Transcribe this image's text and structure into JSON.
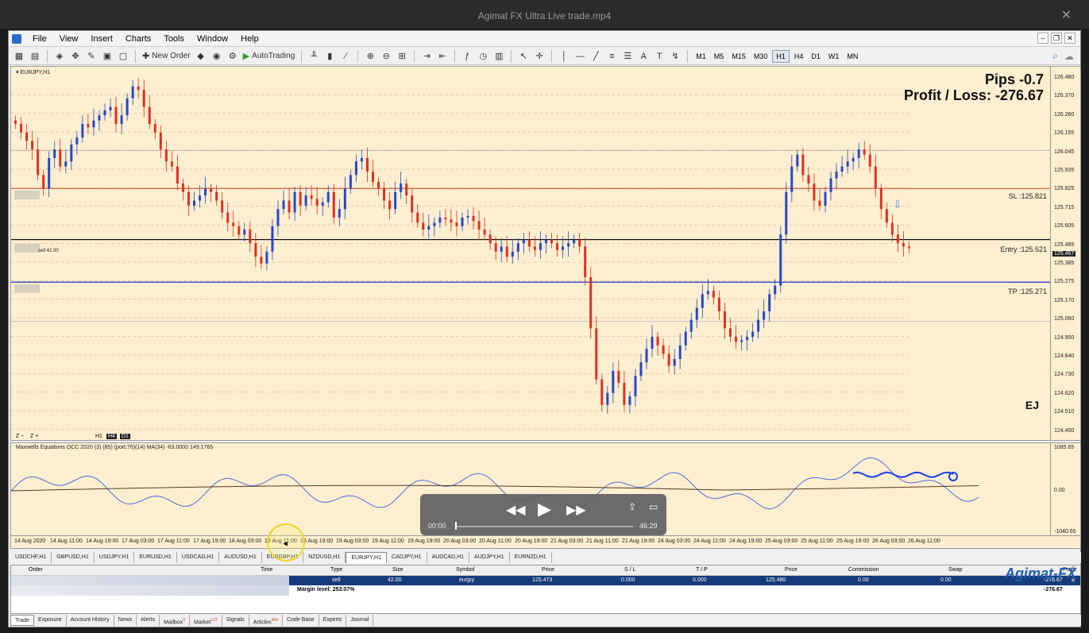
{
  "video": {
    "title": "Agimat FX Ultra Live trade.mp4"
  },
  "menu": [
    "File",
    "View",
    "Insert",
    "Charts",
    "Tools",
    "Window",
    "Help"
  ],
  "toolbar": {
    "new_order": "New Order",
    "autotrading": "AutoTrading",
    "timeframes": [
      "M1",
      "M5",
      "M15",
      "M30",
      "H1",
      "H4",
      "D1",
      "W1",
      "MN"
    ],
    "active_tf": "H1"
  },
  "chart": {
    "symbol": "EURJPY,H1",
    "pips": "Pips -0.7",
    "profit_loss": "Profit / Loss: -276.67",
    "ej": "EJ",
    "sl_label": "SL :125.821",
    "entry_label": "Entry :125.521",
    "tp_label": "TP :125.271",
    "trade_tag": "sell 42.00",
    "current_price": "125.467",
    "tf_mini": [
      "H1",
      "H4",
      "D1"
    ],
    "price_ticks": [
      "126.480",
      "126.370",
      "126.260",
      "126.155",
      "126.045",
      "125.935",
      "125.825",
      "125.715",
      "125.605",
      "125.495",
      "125.385",
      "125.275",
      "125.170",
      "125.060",
      "124.950",
      "124.840",
      "124.730",
      "124.620",
      "124.510",
      "124.400"
    ],
    "time_ticks": [
      "14 Aug 2020",
      "14 Aug 11:00",
      "14 Aug 19:00",
      "17 Aug 03:00",
      "17 Aug 11:00",
      "17 Aug 19:00",
      "18 Aug 03:00",
      "18 Aug 11:00",
      "18 Aug 19:00",
      "19 Aug 03:00",
      "19 Aug 11:00",
      "19 Aug 19:00",
      "20 Aug 03:00",
      "20 Aug 11:00",
      "20 Aug 19:00",
      "21 Aug 03:00",
      "21 Aug 11:00",
      "21 Aug 19:00",
      "24 Aug 03:00",
      "24 Aug 11:00",
      "24 Aug 19:00",
      "25 Aug 03:00",
      "25 Aug 11:00",
      "25 Aug 19:00",
      "26 Aug 03:00",
      "26 Aug 11:00"
    ]
  },
  "indicator": {
    "label": "Maxwells Equations OCC 2020 (3) (85) (port:76)(14) MA(34) -63.0000 149.1765",
    "ticks": [
      "1085.65",
      "0.00",
      "-1040.65"
    ]
  },
  "symbol_tabs": [
    "USDCHF,H1",
    "GBPUSD,H1",
    "USDJPY,H1",
    "EURUSD,H1",
    "USDCAD,H1",
    "AUDUSD,H1",
    "EURGBP,H1",
    "NZDUSD,H1",
    "EURJPY,H1",
    "CADJPY,H1",
    "AUDCAD,H1",
    "AUDJPY,H1",
    "EURNZD,H1"
  ],
  "active_symbol_tab": "EURJPY,H1",
  "terminal": {
    "headers": [
      "Order",
      "Time",
      "Type",
      "Size",
      "Symbol",
      "Price",
      "S / L",
      "T / P",
      "Price",
      "Commission",
      "Swap",
      "Profit"
    ],
    "row": {
      "type": "sell",
      "size": "42.00",
      "symbol": "eurjpy",
      "price": "125.473",
      "sl": "0.000",
      "tp": "0.000",
      "cur_price": "125.480",
      "commission": "0.00",
      "swap": "0.00",
      "profit": "-276.67"
    },
    "margin": "Margin level: 253.07%",
    "total": "-276.67"
  },
  "bottom_tabs": [
    {
      "label": "Trade",
      "badge": ""
    },
    {
      "label": "Exposure",
      "badge": ""
    },
    {
      "label": "Account History",
      "badge": ""
    },
    {
      "label": "News",
      "badge": ""
    },
    {
      "label": "Alerts",
      "badge": ""
    },
    {
      "label": "Mailbox",
      "badge": "9"
    },
    {
      "label": "Market",
      "badge": "137"
    },
    {
      "label": "Signals",
      "badge": ""
    },
    {
      "label": "Articles",
      "badge": "943"
    },
    {
      "label": "Code Base",
      "badge": ""
    },
    {
      "label": "Experts",
      "badge": ""
    },
    {
      "label": "Journal",
      "badge": ""
    }
  ],
  "player": {
    "current": "00:00",
    "duration": "46:29"
  },
  "brand": "Agimat-FX",
  "colors": {
    "bull": "#2747c9",
    "bear": "#e03020",
    "sl_line": "#e04030",
    "tp_line": "#2030c0",
    "bg": "#fdefd0"
  },
  "chart_data": {
    "type": "candlestick",
    "ylim": [
      124.4,
      126.48
    ],
    "close_series": [
      126.2,
      126.15,
      126.1,
      126.05,
      125.9,
      125.82,
      126.0,
      126.05,
      125.95,
      125.98,
      126.08,
      126.12,
      126.2,
      126.18,
      126.22,
      126.25,
      126.28,
      126.3,
      126.2,
      126.25,
      126.35,
      126.42,
      126.4,
      126.3,
      126.2,
      126.15,
      126.05,
      125.98,
      125.95,
      125.85,
      125.8,
      125.72,
      125.75,
      125.78,
      125.82,
      125.8,
      125.75,
      125.68,
      125.62,
      125.6,
      125.55,
      125.58,
      125.5,
      125.42,
      125.38,
      125.45,
      125.6,
      125.7,
      125.75,
      125.68,
      125.8,
      125.72,
      125.78,
      125.76,
      125.72,
      125.74,
      125.8,
      125.65,
      125.7,
      125.82,
      125.9,
      125.98,
      126.0,
      125.92,
      125.86,
      125.82,
      125.75,
      125.7,
      125.8,
      125.85,
      125.78,
      125.68,
      125.62,
      125.58,
      125.6,
      125.62,
      125.65,
      125.64,
      125.62,
      125.6,
      125.65,
      125.66,
      125.63,
      125.58,
      125.55,
      125.5,
      125.45,
      125.48,
      125.42,
      125.45,
      125.5,
      125.52,
      125.48,
      125.46,
      125.5,
      125.52,
      125.5,
      125.46,
      125.48,
      125.5,
      125.52,
      125.48,
      125.3,
      125.0,
      124.7,
      124.55,
      124.62,
      124.75,
      124.68,
      124.55,
      124.6,
      124.72,
      124.8,
      124.88,
      124.95,
      124.9,
      124.85,
      124.78,
      124.82,
      124.9,
      124.98,
      125.05,
      125.12,
      125.2,
      125.22,
      125.18,
      125.1,
      125.0,
      124.95,
      124.92,
      124.93,
      124.95,
      124.98,
      125.05,
      125.1,
      125.2,
      125.25,
      125.55,
      125.8,
      125.95,
      126.02,
      125.9,
      125.85,
      125.75,
      125.72,
      125.8,
      125.88,
      125.92,
      125.95,
      125.98,
      126.0,
      126.05,
      126.02,
      125.95,
      125.82,
      125.7,
      125.62,
      125.55,
      125.5,
      125.48,
      125.47
    ]
  }
}
